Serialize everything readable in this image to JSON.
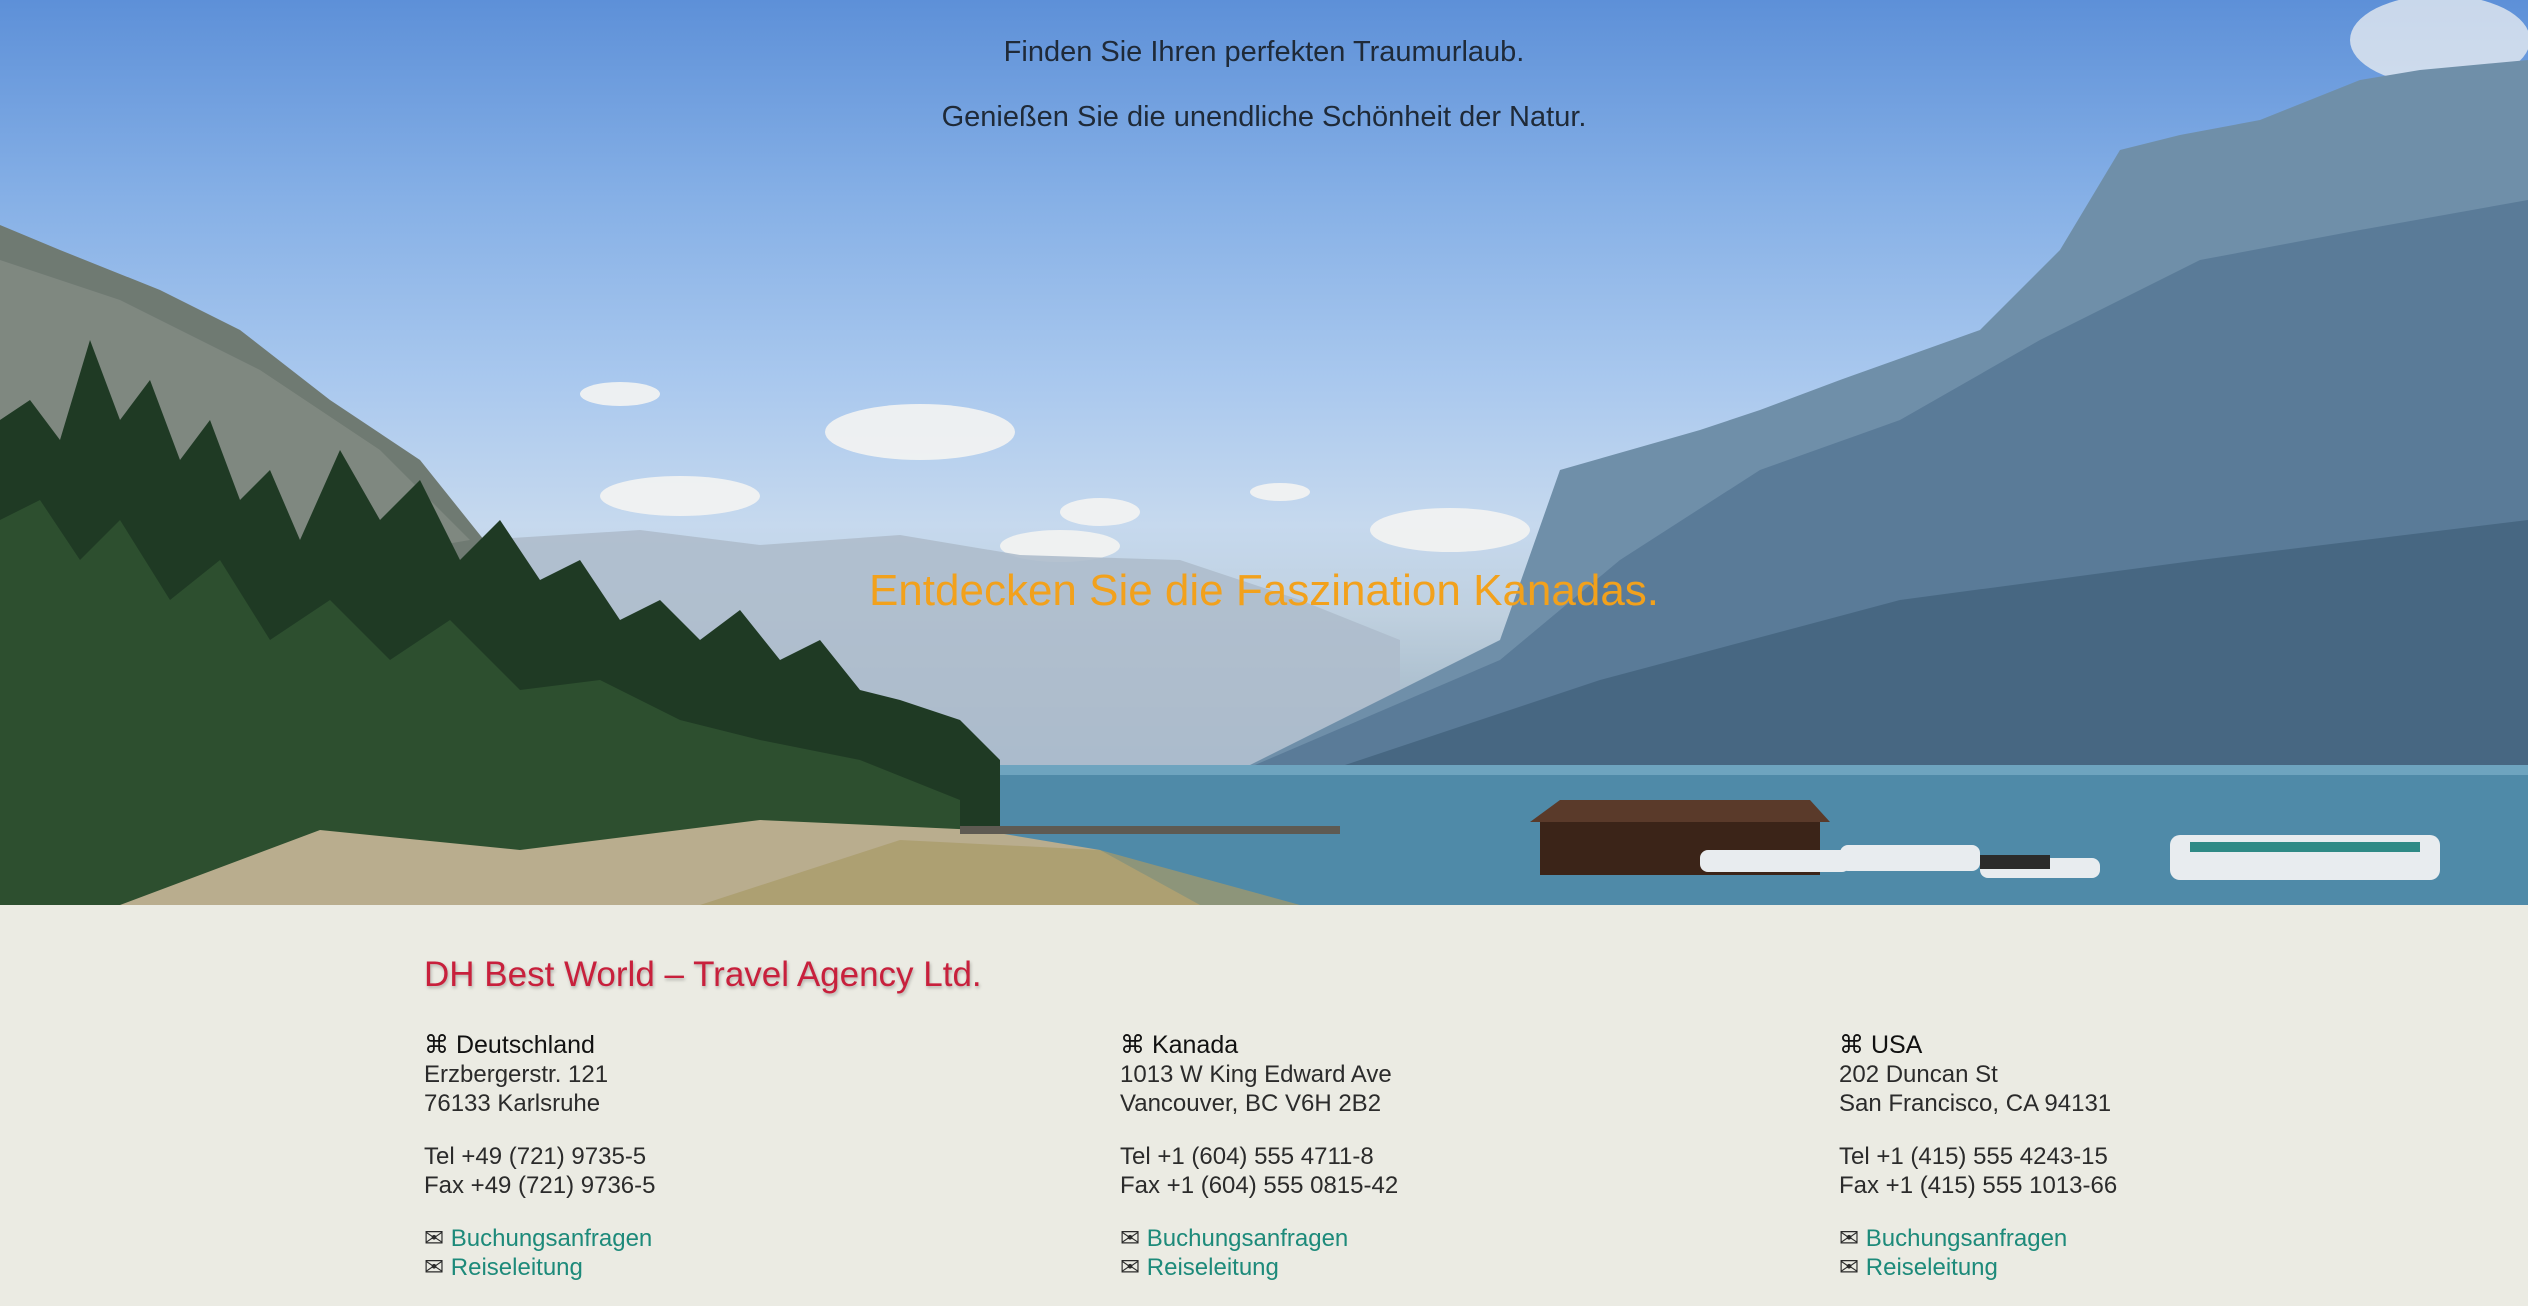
{
  "hero": {
    "tagline_1": "Finden Sie Ihren perfekten Traumurlaub.",
    "tagline_2": "Genießen Sie die unendliche Schönheit der Natur.",
    "headline": "Entdecken Sie die Faszination Kanadas.",
    "colors": {
      "headline": "#f2a11c",
      "tagline": "#1f2a38"
    }
  },
  "footer": {
    "company": "DH Best World – Travel Agency Ltd.",
    "office_icon": "⌘",
    "mail_icon": "✉",
    "offices": [
      {
        "country": "Deutschland",
        "street": "Erzbergerstr. 121",
        "city": "76133 Karlsruhe",
        "tel": "Tel +49 (721) 9735-5",
        "fax": "Fax +49 (721) 9736-5",
        "links": [
          "Buchungsanfragen",
          "Reiseleitung"
        ]
      },
      {
        "country": "Kanada",
        "street": "1013 W King Edward Ave",
        "city": "Vancouver, BC V6H 2B2",
        "tel": "Tel +1 (604) 555 4711-8",
        "fax": "Fax +1 (604) 555 0815-42",
        "links": [
          "Buchungsanfragen",
          "Reiseleitung"
        ]
      },
      {
        "country": "USA",
        "street": "202 Duncan St",
        "city": "San Francisco, CA 94131",
        "tel": "Tel +1 (415) 555 4243-15",
        "fax": "Fax +1 (415) 555 1013-66",
        "links": [
          "Buchungsanfragen",
          "Reiseleitung"
        ]
      }
    ],
    "colors": {
      "company": "#c8203c",
      "link": "#1d8a7a",
      "background": "#ebebe3"
    }
  }
}
